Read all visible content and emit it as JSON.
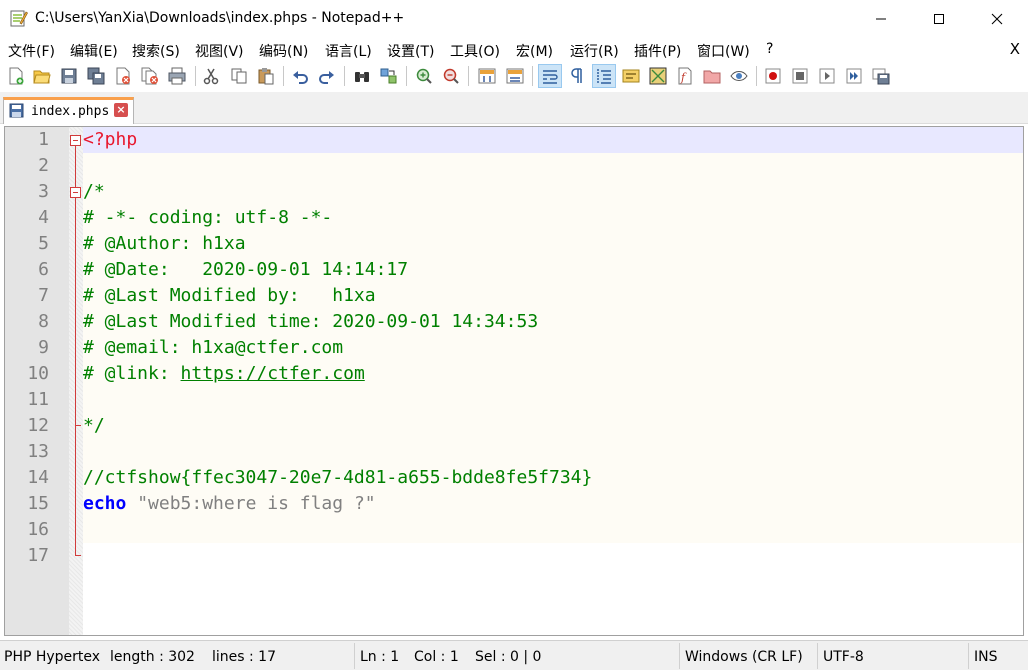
{
  "window": {
    "title": "C:\\Users\\YanXia\\Downloads\\index.phps - Notepad++"
  },
  "menu": {
    "items": [
      "文件(F)",
      "编辑(E)",
      "搜索(S)",
      "视图(V)",
      "编码(N)",
      "语言(L)",
      "设置(T)",
      "工具(O)",
      "宏(M)",
      "运行(R)",
      "插件(P)",
      "窗口(W)",
      "?"
    ],
    "close": "X"
  },
  "tab": {
    "label": "index.phps",
    "close": "×"
  },
  "editor": {
    "line_numbers": [
      "1",
      "2",
      "3",
      "4",
      "5",
      "6",
      "7",
      "8",
      "9",
      "10",
      "11",
      "12",
      "13",
      "14",
      "15",
      "16",
      "17"
    ],
    "lines": {
      "l1": "<?php",
      "l3": "/*",
      "l4": "# -*- coding: utf-8 -*-",
      "l5": "# @Author: h1xa",
      "l6": "# @Date:   2020-09-01 14:14:17",
      "l7": "# @Last Modified by:   h1xa",
      "l8": "# @Last Modified time: 2020-09-01 14:34:53",
      "l9": "# @email: h1xa@ctfer.com",
      "l10_prefix": "# @link: ",
      "l10_link": "https://ctfer.com",
      "l12": "*/",
      "l14": "//ctfshow{ffec3047-20e7-4d81-a655-bdde8fe5f734}",
      "l15_kw": "echo",
      "l15_str": "\"web5:where is flag ?\""
    }
  },
  "statusbar": {
    "language": "PHP Hypertex",
    "length": "length : 302",
    "lines": "lines : 17",
    "ln": "Ln : 1",
    "col": "Col : 1",
    "sel": "Sel : 0 | 0",
    "eol": "Windows (CR LF)",
    "encoding": "UTF-8",
    "mode": "INS"
  },
  "colors": {
    "php_tag": "#e8172d",
    "comment": "#008000",
    "keyword": "#0000ff",
    "string": "#808080",
    "current_line": "#e8e8ff",
    "fold_marker": "#d13b3b"
  }
}
